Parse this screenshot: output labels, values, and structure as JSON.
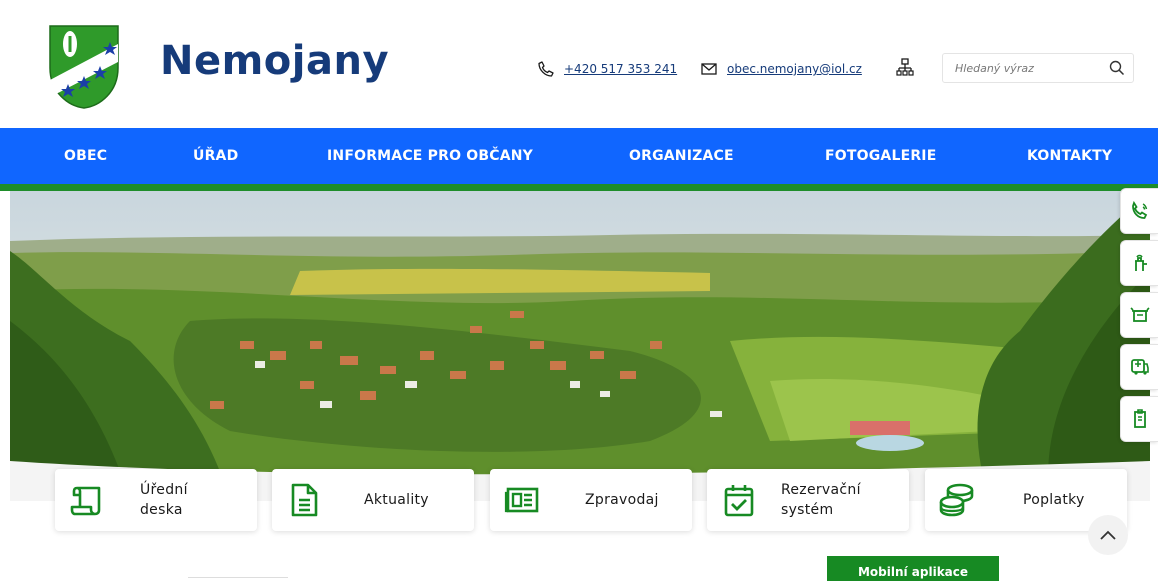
{
  "header": {
    "site_title": "Nemojany",
    "phone": "+420 517 353 241",
    "email": "obec.nemojany@iol.cz",
    "search_placeholder": "Hledaný výraz",
    "icons": [
      "crest-logo",
      "phone-icon",
      "mail-icon",
      "sitemap-icon",
      "search-icon"
    ]
  },
  "nav": {
    "items": [
      "OBEC",
      "ÚŘAD",
      "INFORMACE PRO OBČANY",
      "ORGANIZACE",
      "FOTOGALERIE",
      "KONTAKTY"
    ]
  },
  "sidebar": {
    "icons": [
      "phone-waves-icon",
      "fire-hydrant-icon",
      "bin-icon",
      "bus-icon",
      "document-icon"
    ]
  },
  "tiles": [
    {
      "label": "Úřední\ndeska",
      "icon": "scroll-icon"
    },
    {
      "label": "Aktuality",
      "icon": "file-text-icon"
    },
    {
      "label": "Zpravodaj",
      "icon": "newspaper-icon"
    },
    {
      "label": "Rezervační\nsystém",
      "icon": "calendar-check-icon"
    },
    {
      "label": "Poplatky",
      "icon": "coins-icon"
    }
  ],
  "mobile_app_label": "Mobilní aplikace",
  "colors": {
    "nav_blue": "#1066ff",
    "accent_green": "#1e8d2a",
    "title_blue": "#163b7a"
  }
}
